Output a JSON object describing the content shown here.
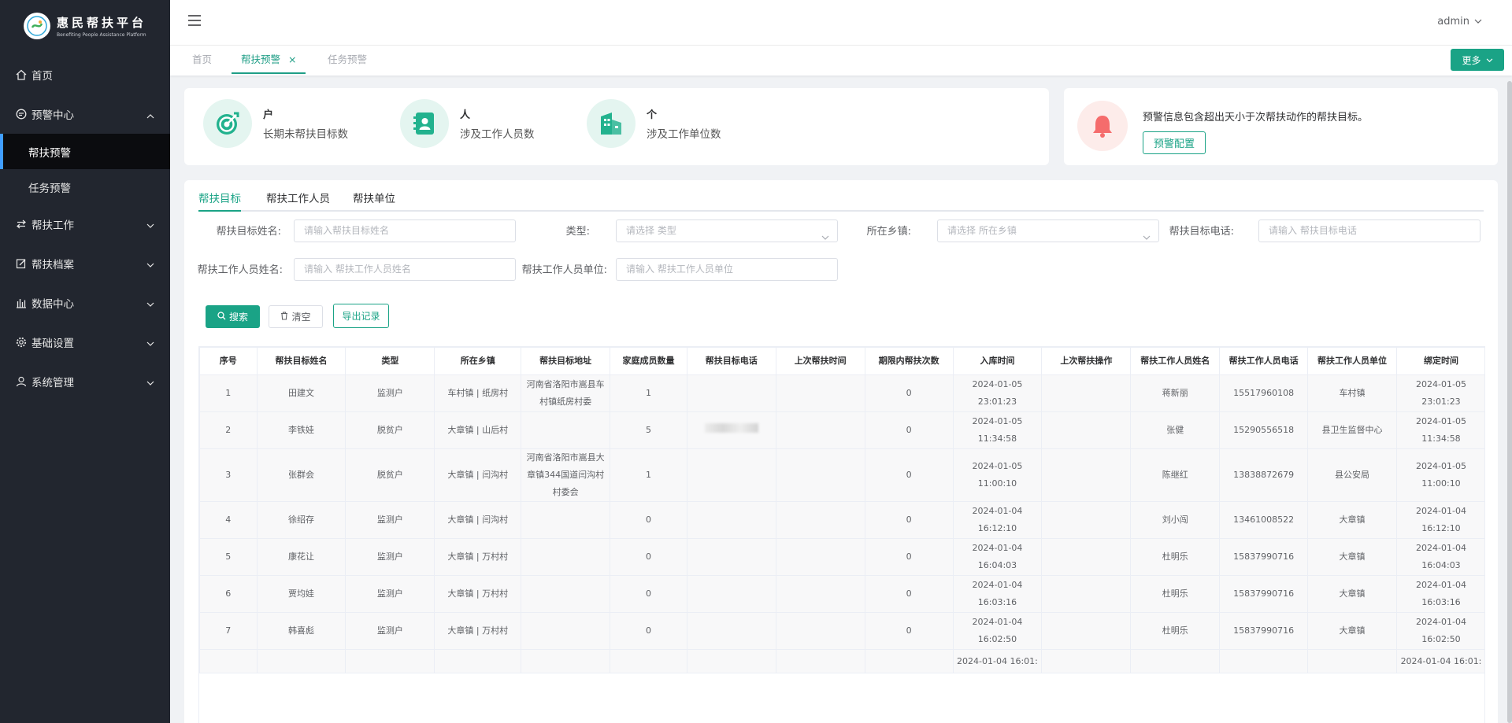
{
  "sidebar": {
    "logo_title": "惠民帮扶平台",
    "logo_subtitle": "Benefiting People Assistance Platform",
    "items": [
      {
        "label": "首页",
        "icon": "home-icon"
      },
      {
        "label": "预警中心",
        "icon": "message-icon",
        "expanded": true,
        "children": [
          {
            "label": "帮扶预警",
            "active": true
          },
          {
            "label": "任务预警",
            "active": false
          }
        ]
      },
      {
        "label": "帮扶工作",
        "icon": "switch-icon"
      },
      {
        "label": "帮扶档案",
        "icon": "edit-icon"
      },
      {
        "label": "数据中心",
        "icon": "chart-icon"
      },
      {
        "label": "基础设置",
        "icon": "gear-icon"
      },
      {
        "label": "系统管理",
        "icon": "user-icon"
      }
    ]
  },
  "header": {
    "username": "admin"
  },
  "tabs": {
    "items": [
      {
        "label": "首页",
        "active": false
      },
      {
        "label": "帮扶预警",
        "active": true
      },
      {
        "label": "任务预警",
        "active": false
      }
    ],
    "more_label": "更多"
  },
  "stats": [
    {
      "unit": "户",
      "label": "长期未帮扶目标数",
      "icon": "target-icon"
    },
    {
      "unit": "人",
      "label": "涉及工作人员数",
      "icon": "contacts-book-icon"
    },
    {
      "unit": "个",
      "label": "涉及工作单位数",
      "icon": "building-icon"
    }
  ],
  "alert": {
    "text": "预警信息包含超出天小于次帮扶动作的帮扶目标。",
    "button": "预警配置"
  },
  "inner_tabs": [
    "帮扶目标",
    "帮扶工作人员",
    "帮扶单位"
  ],
  "filters": {
    "name_label": "帮扶目标姓名:",
    "name_placeholder": "请输入帮扶目标姓名",
    "type_label": "类型:",
    "type_placeholder": "请选择 类型",
    "town_label": "所在乡镇:",
    "town_placeholder": "请选择 所在乡镇",
    "phone_label": "帮扶目标电话:",
    "phone_placeholder": "请输入 帮扶目标电话",
    "worker_label": "帮扶工作人员姓名:",
    "worker_placeholder": "请输入 帮扶工作人员姓名",
    "unit_label": "帮扶工作人员单位:",
    "unit_placeholder": "请输入 帮扶工作人员单位"
  },
  "actions": {
    "search": "搜索",
    "clear": "清空",
    "export": "导出记录"
  },
  "table": {
    "headers": [
      "序号",
      "帮扶目标姓名",
      "类型",
      "所在乡镇",
      "帮扶目标地址",
      "家庭成员数量",
      "帮扶目标电话",
      "上次帮扶时间",
      "期限内帮扶次数",
      "入库时间",
      "上次帮扶操作",
      "帮扶工作人员姓名",
      "帮扶工作人员电话",
      "帮扶工作人员单位",
      "绑定时间"
    ],
    "rows": [
      {
        "no": "1",
        "name": "田建文",
        "type": "监测户",
        "town": "车村镇 | 纸房村",
        "addr": "河南省洛阳市嵩县车村镇纸房村委",
        "members": "1",
        "phone": "",
        "last_time": "",
        "count": "0",
        "in_time": "2024-01-05 23:01:23",
        "last_op": "",
        "worker": "蒋新丽",
        "worker_phone": "15517960108",
        "worker_unit": "车村镇",
        "bind_time": "2024-01-05 23:01:23"
      },
      {
        "no": "2",
        "name": "李铁娃",
        "type": "脱贫户",
        "town": "大章镇 | 山后村",
        "addr": "",
        "members": "5",
        "phone": "blurred",
        "last_time": "",
        "count": "0",
        "in_time": "2024-01-05 11:34:58",
        "last_op": "",
        "worker": "张健",
        "worker_phone": "15290556518",
        "worker_unit": "县卫生监督中心",
        "bind_time": "2024-01-05 11:34:58"
      },
      {
        "no": "3",
        "name": "张群会",
        "type": "脱贫户",
        "town": "大章镇 | 闫沟村",
        "addr": "河南省洛阳市嵩县大章镇344国道闫沟村村委会",
        "members": "1",
        "phone": "",
        "last_time": "",
        "count": "0",
        "in_time": "2024-01-05 11:00:10",
        "last_op": "",
        "worker": "陈继红",
        "worker_phone": "13838872679",
        "worker_unit": "县公安局",
        "bind_time": "2024-01-05 11:00:10"
      },
      {
        "no": "4",
        "name": "徐绍存",
        "type": "监测户",
        "town": "大章镇 | 闫沟村",
        "addr": "",
        "members": "0",
        "phone": "",
        "last_time": "",
        "count": "0",
        "in_time": "2024-01-04 16:12:10",
        "last_op": "",
        "worker": "刘小闯",
        "worker_phone": "13461008522",
        "worker_unit": "大章镇",
        "bind_time": "2024-01-04 16:12:10"
      },
      {
        "no": "5",
        "name": "康花让",
        "type": "监测户",
        "town": "大章镇 | 万村村",
        "addr": "",
        "members": "0",
        "phone": "",
        "last_time": "",
        "count": "0",
        "in_time": "2024-01-04 16:04:03",
        "last_op": "",
        "worker": "杜明乐",
        "worker_phone": "15837990716",
        "worker_unit": "大章镇",
        "bind_time": "2024-01-04 16:04:03"
      },
      {
        "no": "6",
        "name": "贾均娃",
        "type": "监测户",
        "town": "大章镇 | 万村村",
        "addr": "",
        "members": "0",
        "phone": "",
        "last_time": "",
        "count": "0",
        "in_time": "2024-01-04 16:03:16",
        "last_op": "",
        "worker": "杜明乐",
        "worker_phone": "15837990716",
        "worker_unit": "大章镇",
        "bind_time": "2024-01-04 16:03:16"
      },
      {
        "no": "7",
        "name": "韩喜彪",
        "type": "监测户",
        "town": "大章镇 | 万村村",
        "addr": "",
        "members": "0",
        "phone": "",
        "last_time": "",
        "count": "0",
        "in_time": "2024-01-04 16:02:50",
        "last_op": "",
        "worker": "杜明乐",
        "worker_phone": "15837990716",
        "worker_unit": "大章镇",
        "bind_time": "2024-01-04 16:02:50"
      },
      {
        "no": "",
        "name": "",
        "type": "",
        "town": "",
        "addr": "",
        "members": "",
        "phone": "",
        "last_time": "",
        "count": "",
        "in_time": "2024-01-04 16:01:",
        "last_op": "",
        "worker": "",
        "worker_phone": "",
        "worker_unit": "",
        "bind_time": "2024-01-04 16:01:"
      }
    ]
  },
  "colors": {
    "accent": "#1aa386",
    "sidebar_bg": "#22262f",
    "active_bar": "#409eff",
    "alert_red": "#f56c6c"
  }
}
